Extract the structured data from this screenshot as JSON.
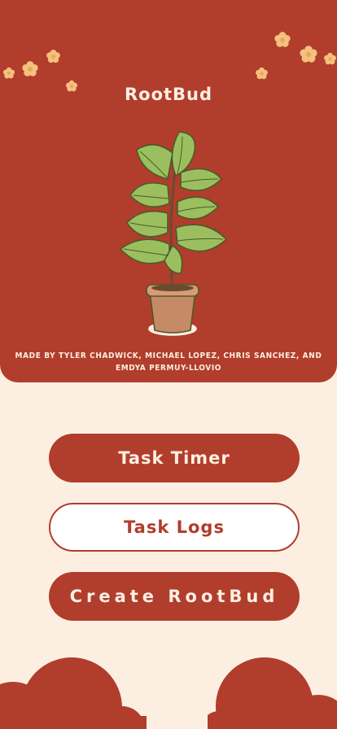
{
  "app": {
    "title": "RootBud"
  },
  "credits": "MADE BY TYLER CHADWICK, MICHAEL LOPEZ, CHRIS SANCHEZ, AND EMDYA PERMUY-LLOVIO",
  "buttons": {
    "task_timer": "Task Timer",
    "task_logs": "Task Logs",
    "create_rootbud": "Create RootBud"
  },
  "colors": {
    "primary": "#b13d2c",
    "background": "#fcefe1",
    "flower": "#f6c07e",
    "leaf": "#9bbf5e",
    "pot": "#c68a67"
  },
  "icons": {
    "flower": "flower-icon",
    "plant": "fiddle-leaf-fig-plant",
    "cloud": "cloud-shape"
  }
}
